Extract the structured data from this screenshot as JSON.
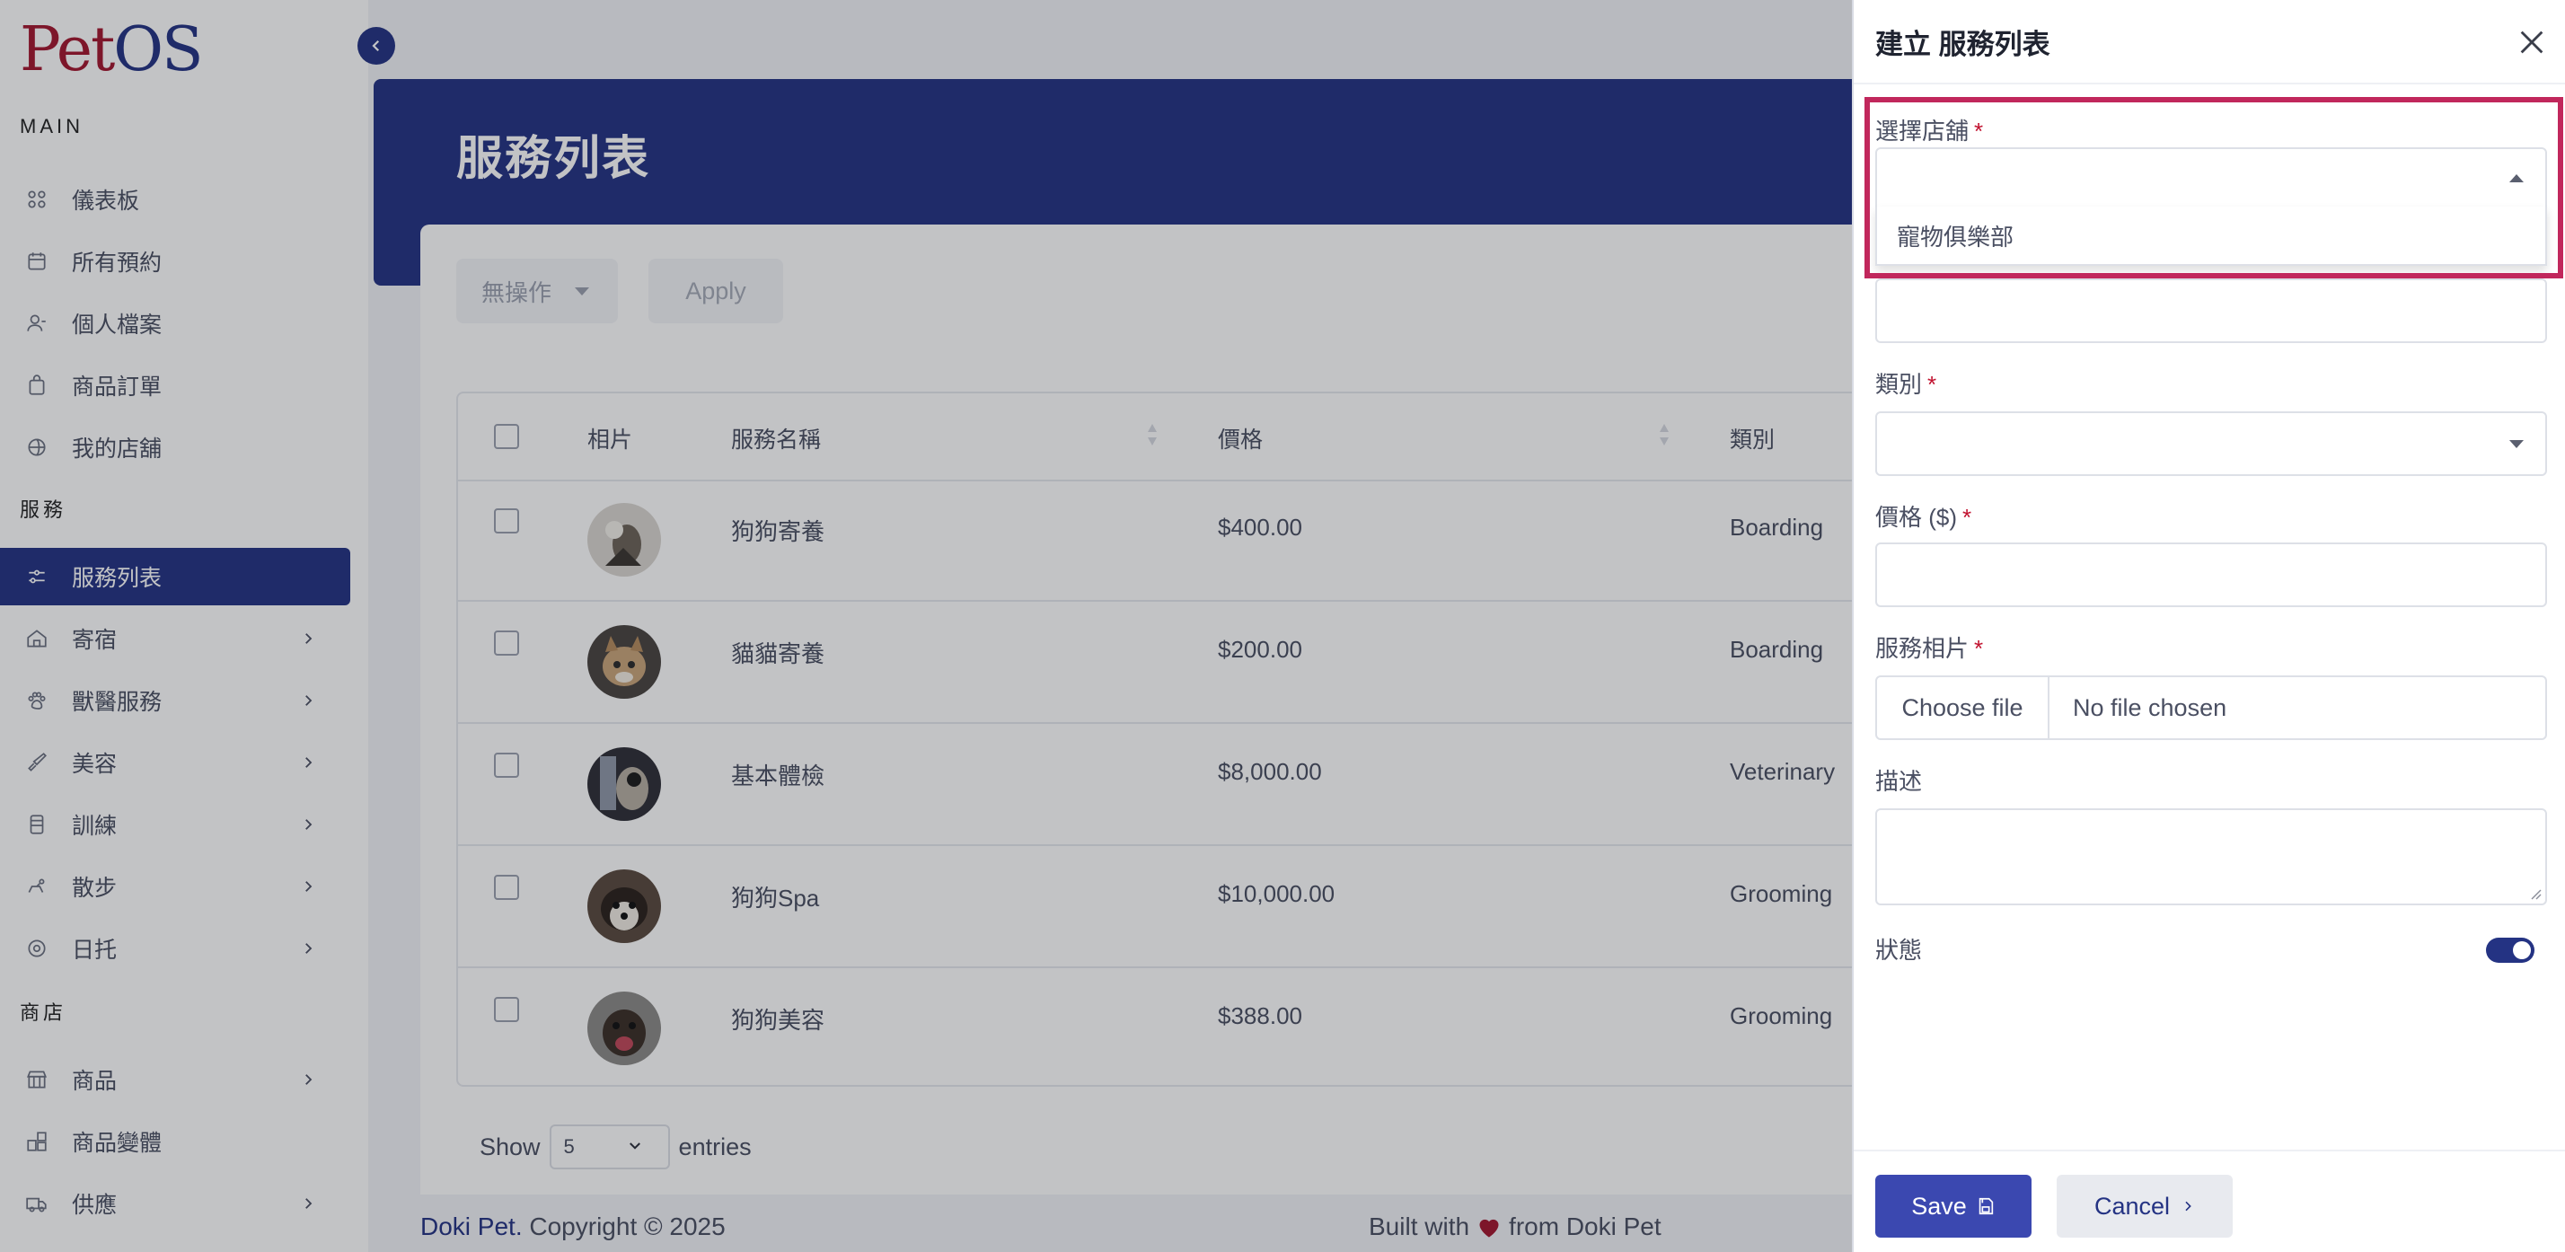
{
  "app": {
    "logo_pet": "Pet",
    "logo_os": "OS",
    "brand_color": "#243383",
    "accent_color": "#a3162f"
  },
  "sidebar": {
    "section_main": "MAIN",
    "section_services": "服務",
    "section_shop": "商店",
    "items": [
      {
        "label": "儀表板",
        "icon": "dashboard-icon"
      },
      {
        "label": "所有預約",
        "icon": "calendar-icon"
      },
      {
        "label": "個人檔案",
        "icon": "user-icon"
      },
      {
        "label": "商品訂單",
        "icon": "shopping-bag-icon"
      },
      {
        "label": "我的店舖",
        "icon": "store-icon"
      },
      {
        "label": "服務列表",
        "icon": "list-settings-icon",
        "active": true
      },
      {
        "label": "寄宿",
        "icon": "home-icon"
      },
      {
        "label": "獸醫服務",
        "icon": "vet-icon"
      },
      {
        "label": "美容",
        "icon": "brush-icon"
      },
      {
        "label": "訓練",
        "icon": "training-icon"
      },
      {
        "label": "散步",
        "icon": "dog-walk-icon"
      },
      {
        "label": "日托",
        "icon": "daycare-icon"
      },
      {
        "label": "商品",
        "icon": "products-icon"
      },
      {
        "label": "商品變體",
        "icon": "variants-icon"
      },
      {
        "label": "供應",
        "icon": "truck-icon"
      }
    ]
  },
  "page": {
    "title": "服務列表",
    "bulk_action": "無操作",
    "apply_label": "Apply"
  },
  "table": {
    "headers": {
      "photo": "相片",
      "name": "服務名稱",
      "price": "價格",
      "category": "類別"
    },
    "rows": [
      {
        "name": "狗狗寄養",
        "price": "$400.00",
        "category": "Boarding"
      },
      {
        "name": "貓貓寄養",
        "price": "$200.00",
        "category": "Boarding"
      },
      {
        "name": "基本體檢",
        "price": "$8,000.00",
        "category": "Veterinary"
      },
      {
        "name": "狗狗Spa",
        "price": "$10,000.00",
        "category": "Grooming"
      },
      {
        "name": "狗狗美容",
        "price": "$388.00",
        "category": "Grooming"
      }
    ]
  },
  "pagination": {
    "show_label": "Show",
    "page_size": "5",
    "entries_label": "entries"
  },
  "footer": {
    "brand": "Doki Pet.",
    "copyright": " Copyright © 2025",
    "built_with": "Built with",
    "from": "from Doki Pet"
  },
  "drawer": {
    "title": "建立 服務列表",
    "store_label": "選擇店舖",
    "store_option": "寵物俱樂部",
    "category_label": "類別",
    "price_label": "價格 ($)",
    "photo_label": "服務相片",
    "choose_file": "Choose file",
    "no_file": "No file chosen",
    "description_label": "描述",
    "status_label": "狀態",
    "status_on": true,
    "save_label": "Save",
    "cancel_label": "Cancel",
    "required_mark": "*"
  }
}
